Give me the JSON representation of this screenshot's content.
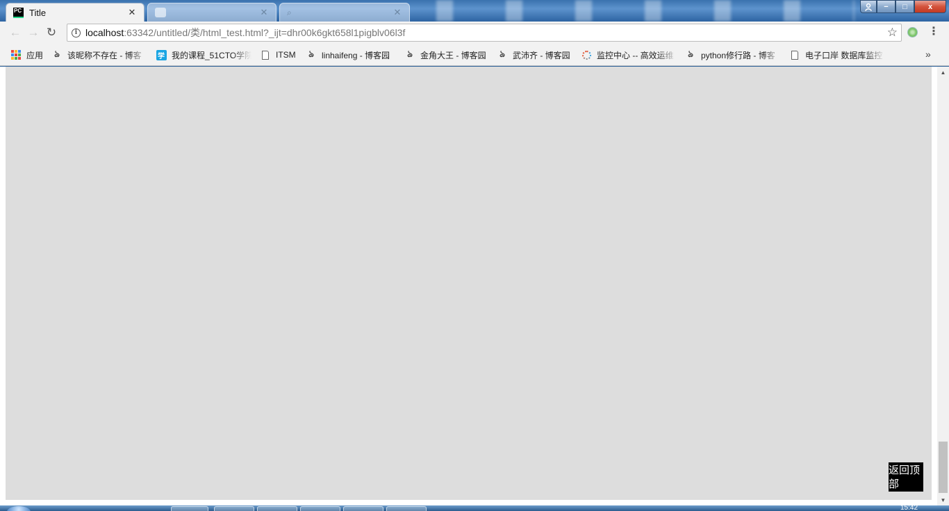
{
  "browser": {
    "active_tab": {
      "title": "Title",
      "favicon": "pycharm-icon",
      "favicon_text": "PC"
    },
    "inactive_tabs": [
      {
        "title": "",
        "favicon": "blank-favicon"
      },
      {
        "title": "",
        "favicon": "search-favicon"
      }
    ],
    "window_controls": {
      "minimize": "−",
      "maximize": "□",
      "close": "x"
    },
    "address": {
      "host": "localhost",
      "path": ":63342/untitled/类/html_test.html?_ijt=dhr00k6gkt658l1pigblv06l3f"
    },
    "icons": {
      "back": "←",
      "forward": "→",
      "reload": "↻",
      "star": "☆",
      "menu": "⋮",
      "chevrons": "»",
      "info": "i"
    }
  },
  "bookmarks": [
    {
      "label": "应用",
      "icon": "apps-grid-icon"
    },
    {
      "label": "该昵称不存在 - 博客",
      "icon": "cnblogs-icon"
    },
    {
      "label": "我的课程_51CTO学院",
      "icon": "xue-icon"
    },
    {
      "label": "ITSM",
      "icon": "page-icon"
    },
    {
      "label": "linhaifeng - 博客园",
      "icon": "cnblogs-icon"
    },
    {
      "label": "金角大王 - 博客园",
      "icon": "cnblogs-icon"
    },
    {
      "label": "武沛齐 - 博客园",
      "icon": "cnblogs-icon"
    },
    {
      "label": "监控中心 -- 高效运维",
      "icon": "spinner-icon"
    },
    {
      "label": "python修行路 - 博客",
      "icon": "cnblogs-icon"
    },
    {
      "label": "电子口岸 数据库监控",
      "icon": "page-icon"
    }
  ],
  "page": {
    "back_to_top": "返回顶部",
    "background_color": "#dddddd"
  },
  "taskbar": {
    "clock": "15:42"
  }
}
